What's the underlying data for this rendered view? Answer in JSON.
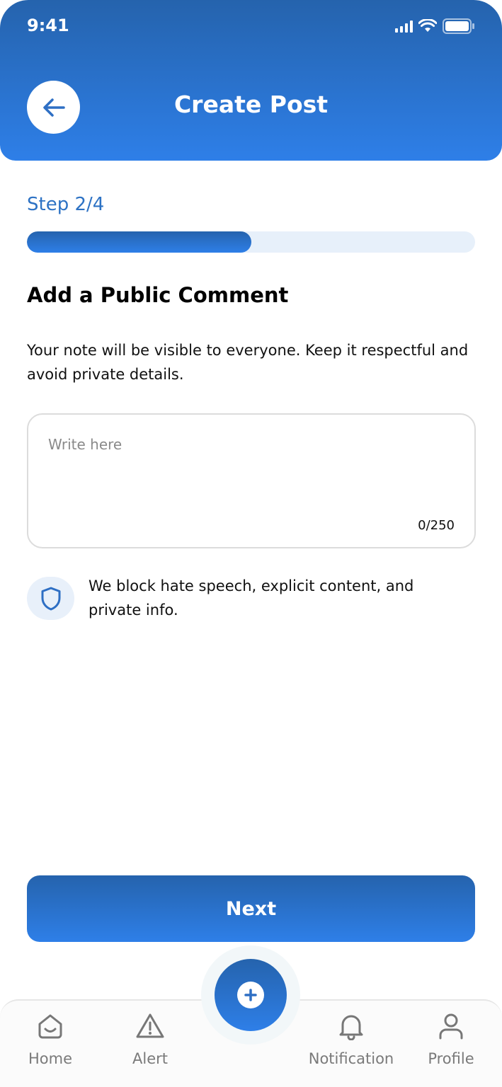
{
  "status_bar": {
    "time": "9:41"
  },
  "header": {
    "title": "Create Post"
  },
  "step": {
    "label": "Step 2/4",
    "progress_fraction": 0.5
  },
  "section": {
    "title": "Add a Public Comment",
    "description": "Your note will be visible to everyone. Keep it respectful and avoid private details."
  },
  "comment_field": {
    "placeholder": "Write here",
    "value": "",
    "counter": "0/250"
  },
  "notice": {
    "text": "We block hate speech, explicit content, and private info."
  },
  "next_button": {
    "label": "Next"
  },
  "tabbar": {
    "items": [
      {
        "label": "Home",
        "icon": "home-icon"
      },
      {
        "label": "Alert",
        "icon": "alert-icon"
      },
      {
        "label": "Notification",
        "icon": "bell-icon"
      },
      {
        "label": "Profile",
        "icon": "user-icon"
      }
    ],
    "fab_icon": "plus-icon"
  },
  "colors": {
    "brand": "#2e7fe8",
    "brand_dark": "#2563ad",
    "track": "#e7f0fa",
    "muted": "#7a7a7a"
  }
}
